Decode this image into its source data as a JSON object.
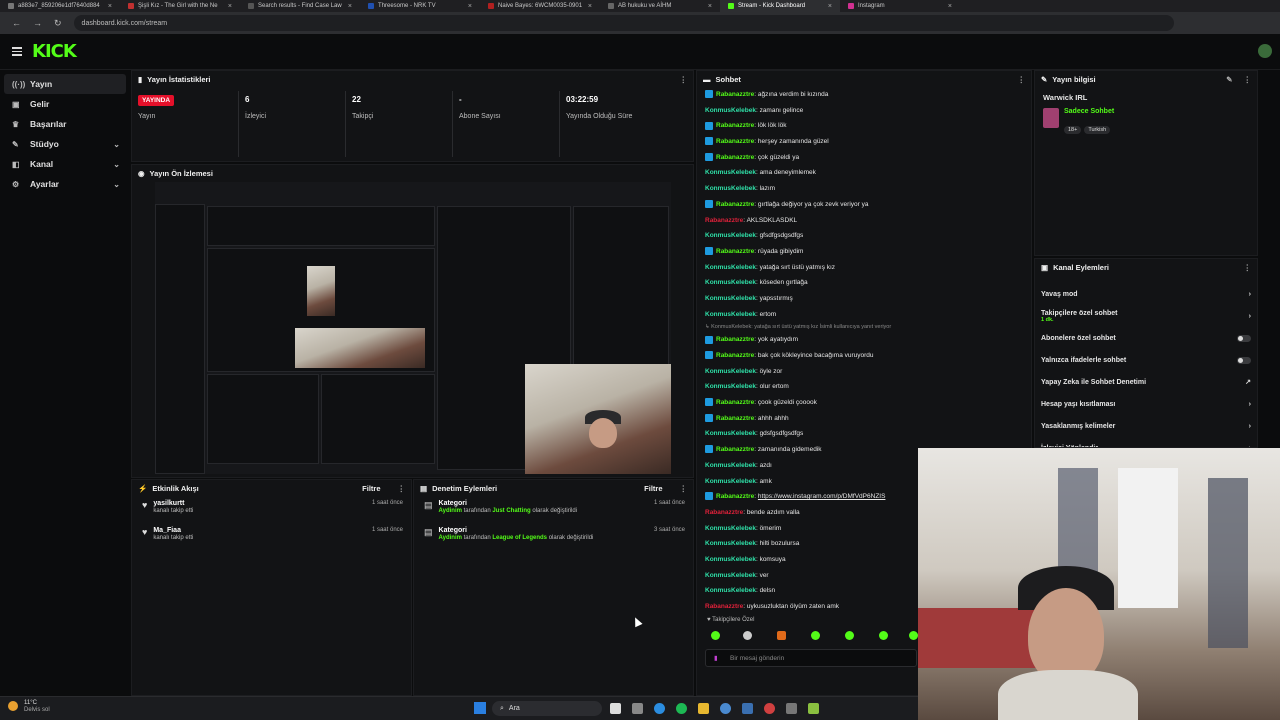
{
  "browser": {
    "tabs": [
      {
        "title": "a883e7_859206e1df7640d884",
        "color": "#777"
      },
      {
        "title": "Şişli Kız - The Girl with the Ne",
        "color": "#c03030"
      },
      {
        "title": "Search results - Find Case Law",
        "color": "#555"
      },
      {
        "title": "Threesome - NRK TV",
        "color": "#2050b0"
      },
      {
        "title": "Naive Bayes: 6WCM0035-0901",
        "color": "#b02020"
      },
      {
        "title": "AB hukuku ve AİHM",
        "color": "#666"
      },
      {
        "title": "Stream - Kick Dashboard",
        "color": "#53fc18"
      },
      {
        "title": "Instagram",
        "color": "#d03090"
      }
    ],
    "url": "dashboard.kick.com/stream"
  },
  "header": {
    "logo": "KICK"
  },
  "sidebar": {
    "items": [
      {
        "label": "Yayın",
        "icon": "broadcast-icon",
        "glyph": "((·))"
      },
      {
        "label": "Gelir",
        "icon": "money-icon",
        "glyph": "▣"
      },
      {
        "label": "Başarılar",
        "icon": "trophy-icon",
        "glyph": "♛"
      },
      {
        "label": "Stüdyo",
        "icon": "studio-icon",
        "glyph": "✎"
      },
      {
        "label": "Kanal",
        "icon": "channel-icon",
        "glyph": "◧"
      },
      {
        "label": "Ayarlar",
        "icon": "gear-icon",
        "glyph": "⚙"
      }
    ]
  },
  "stats": {
    "title": "Yayın İstatistikleri",
    "items": [
      {
        "value": "YAYINDA",
        "label": "Yayın"
      },
      {
        "value": "6",
        "label": "İzleyici"
      },
      {
        "value": "22",
        "label": "Takipçi"
      },
      {
        "value": "-",
        "label": "Abone Sayısı"
      },
      {
        "value": "03:22:59",
        "label": "Yayında Olduğu Süre"
      }
    ]
  },
  "preview": {
    "title": "Yayın Ön İzlemesi"
  },
  "activity": {
    "title": "Etkinlik Akışı",
    "filter": "Filtre",
    "items": [
      {
        "name": "yasilkurtt",
        "sub": "kanalı takip etti",
        "time": "1 saat önce"
      },
      {
        "name": "Ma_Fiaa",
        "sub": "kanalı takip etti",
        "time": "1 saat önce"
      }
    ]
  },
  "moderation": {
    "title": "Denetim Eylemleri",
    "filter": "Filtre",
    "items": [
      {
        "name": "Kategori",
        "actor": "Aydinim",
        "mid": "tarafından",
        "target": "Just Chatting",
        "end": "olarak değiştirildi",
        "time": "1 saat önce"
      },
      {
        "name": "Kategori",
        "actor": "Aydinim",
        "mid": "tarafından",
        "target": "League of Legends",
        "end": "olarak değiştirildi",
        "time": "3 saat önce"
      }
    ]
  },
  "chat": {
    "title": "Sohbet",
    "messages": [
      {
        "user": "Rabanazztre",
        "text": "ağzına verdim bi kızında",
        "color": "#53fc18",
        "badge": true
      },
      {
        "user": "KonmusKelebek",
        "text": "zamanı gelince",
        "color": "#2fe0a8",
        "badge": false
      },
      {
        "user": "Rabanazztre",
        "text": "lök lök lök",
        "color": "#53fc18",
        "badge": true
      },
      {
        "user": "Rabanazztre",
        "text": "herşey zamanında güzel",
        "color": "#53fc18",
        "badge": true
      },
      {
        "user": "Rabanazztre",
        "text": "çok güzeldi ya",
        "color": "#53fc18",
        "badge": true
      },
      {
        "user": "KonmusKelebek",
        "text": "ama deneyimlemek",
        "color": "#2fe0a8",
        "badge": false
      },
      {
        "user": "KonmusKelebek",
        "text": "lazım",
        "color": "#2fe0a8",
        "badge": false
      },
      {
        "user": "Rabanazztre",
        "text": "gırtlağa değiyor ya çok zevk veriyor ya",
        "color": "#53fc18",
        "badge": true
      },
      {
        "user": "Rabanazztre",
        "text": "AKLSDKLASDKL",
        "color": "#e0213a",
        "badge": false
      },
      {
        "user": "KonmusKelebek",
        "text": "gfsdfgsdgsdfgs",
        "color": "#2fe0a8",
        "badge": false
      },
      {
        "user": "Rabanazztre",
        "text": "rüyada gibiydim",
        "color": "#53fc18",
        "badge": true
      },
      {
        "user": "KonmusKelebek",
        "text": "yatağa sırt üstü yatmış kız",
        "color": "#2fe0a8",
        "badge": false
      },
      {
        "user": "KonmusKelebek",
        "text": "köseden gırtlağa",
        "color": "#2fe0a8",
        "badge": false
      },
      {
        "user": "KonmusKelebek",
        "text": "yapsstırmış",
        "color": "#2fe0a8",
        "badge": false
      },
      {
        "user": "KonmusKelebek",
        "text": "ertom",
        "color": "#2fe0a8",
        "badge": false
      },
      {
        "user": "",
        "text": "↳ KonmusKelebek: yatağa sırt üstü yatmış kız İsimli kullanıcıya yanıt veriyor",
        "color": "#8a8a8a",
        "badge": false,
        "reply": true
      },
      {
        "user": "Rabanazztre",
        "text": "yok ayatıydım",
        "color": "#53fc18",
        "badge": true
      },
      {
        "user": "Rabanazztre",
        "text": "bak çok kökleyince bacağıma vuruyordu",
        "color": "#53fc18",
        "badge": true
      },
      {
        "user": "KonmusKelebek",
        "text": "öyle zor",
        "color": "#2fe0a8",
        "badge": false
      },
      {
        "user": "KonmusKelebek",
        "text": "olur ertom",
        "color": "#2fe0a8",
        "badge": false
      },
      {
        "user": "Rabanazztre",
        "text": "çook güzeldi çooook",
        "color": "#53fc18",
        "badge": true
      },
      {
        "user": "Rabanazztre",
        "text": "ahhh ahhh",
        "color": "#53fc18",
        "badge": true
      },
      {
        "user": "KonmusKelebek",
        "text": "gdsfgsdfgsdfgs",
        "color": "#2fe0a8",
        "badge": false
      },
      {
        "user": "Rabanazztre",
        "text": "zamanında gidemedik",
        "color": "#53fc18",
        "badge": true
      },
      {
        "user": "KonmusKelebek",
        "text": "azdı",
        "color": "#2fe0a8",
        "badge": false
      },
      {
        "user": "KonmusKelebek",
        "text": "amk",
        "color": "#2fe0a8",
        "badge": false
      },
      {
        "user": "Rabanazztre",
        "text": "https://www.instagram.com/p/DMfVdP6NZIS",
        "color": "#53fc18",
        "badge": true,
        "link": true
      },
      {
        "user": "Rabanazztre",
        "text": "bende azdım valla",
        "color": "#e0213a",
        "badge": false
      },
      {
        "user": "KonmusKelebek",
        "text": "ömerim",
        "color": "#2fe0a8",
        "badge": false
      },
      {
        "user": "KonmusKelebek",
        "text": "hilti bozulursa",
        "color": "#2fe0a8",
        "badge": false
      },
      {
        "user": "KonmusKelebek",
        "text": "komsuya",
        "color": "#2fe0a8",
        "badge": false
      },
      {
        "user": "KonmusKelebek",
        "text": "ver",
        "color": "#2fe0a8",
        "badge": false
      },
      {
        "user": "KonmusKelebek",
        "text": "delsn",
        "color": "#2fe0a8",
        "badge": false
      },
      {
        "user": "Rabanazztre",
        "text": "uykusuzluktan ölyüm zaten amk",
        "color": "#e0213a",
        "badge": false
      }
    ],
    "followers_only": "♥ Takipçilere Özel",
    "input_placeholder": "Bir mesaj gönderin"
  },
  "stream_info": {
    "title": "Yayın bilgisi",
    "stream_title": "Warwick IRL",
    "category": "Sadece Sohbet",
    "tags": [
      "18+",
      "Turkish"
    ]
  },
  "channel_actions": {
    "title": "Kanal Eylemleri",
    "items": [
      {
        "label": "Yavaş mod",
        "kind": "chevron"
      },
      {
        "label": "Takipçilere özel sohbet",
        "sub": "1 dk.",
        "kind": "chevron"
      },
      {
        "label": "Abonelere özel sohbet",
        "kind": "toggle"
      },
      {
        "label": "Yalnızca ifadelerle sohbet",
        "kind": "toggle"
      },
      {
        "label": "Yapay Zeka ile Sohbet Denetimi",
        "kind": "external"
      },
      {
        "label": "Hesap yaşı kısıtlaması",
        "kind": "chevron"
      },
      {
        "label": "Yasaklanmış kelimeler",
        "kind": "chevron"
      },
      {
        "label": "İzleyici Yönlendir",
        "kind": "chevron"
      }
    ]
  },
  "taskbar": {
    "weather_temp": "11°C",
    "weather_desc": "Delvis sol",
    "search": "Ara"
  }
}
